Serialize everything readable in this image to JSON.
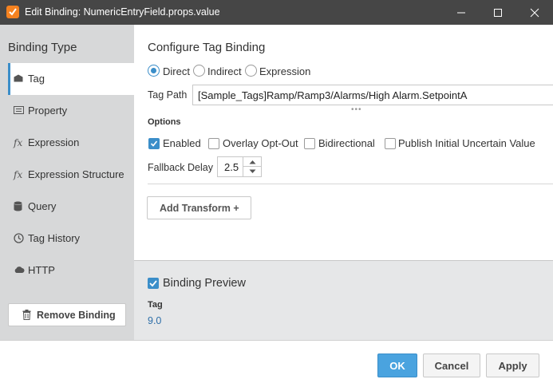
{
  "window": {
    "title": "Edit Binding: NumericEntryField.props.value",
    "minimize": "minimize",
    "maximize": "maximize",
    "close": "close"
  },
  "sidebar": {
    "heading": "Binding Type",
    "items": [
      {
        "label": "Tag",
        "icon": "tag-icon",
        "selected": true
      },
      {
        "label": "Property",
        "icon": "property-icon"
      },
      {
        "label": "Expression",
        "icon": "expression-icon"
      },
      {
        "label": "Expression Structure",
        "icon": "expression-structure-icon"
      },
      {
        "label": "Query",
        "icon": "database-icon"
      },
      {
        "label": "Tag History",
        "icon": "clock-icon"
      },
      {
        "label": "HTTP",
        "icon": "cloud-icon"
      }
    ],
    "remove_label": "Remove Binding"
  },
  "config": {
    "title": "Configure Tag Binding",
    "modes": [
      {
        "label": "Direct",
        "selected": true
      },
      {
        "label": "Indirect",
        "selected": false
      },
      {
        "label": "Expression",
        "selected": false
      }
    ],
    "tag_path_label": "Tag Path",
    "tag_path_value": "[Sample_Tags]Ramp/Ramp3/Alarms/High Alarm.SetpointA",
    "options_label": "Options",
    "options": [
      {
        "label": "Enabled",
        "checked": true
      },
      {
        "label": "Overlay Opt-Out",
        "checked": false
      },
      {
        "label": "Bidirectional",
        "checked": false
      },
      {
        "label": "Publish Initial Uncertain Value",
        "checked": false
      }
    ],
    "fallback_label": "Fallback Delay",
    "fallback_value": "2.5",
    "add_transform_label": "Add Transform +"
  },
  "preview": {
    "checked": true,
    "title": "Binding Preview",
    "tag_label": "Tag",
    "value": "9.0"
  },
  "footer": {
    "ok_label": "OK",
    "cancel_label": "Cancel",
    "apply_label": "Apply"
  },
  "colors": {
    "accent": "#3b8ec9",
    "titlebar": "#464646",
    "sidebar": "#d7d8d9",
    "preview_bg": "#e6e7e8"
  }
}
